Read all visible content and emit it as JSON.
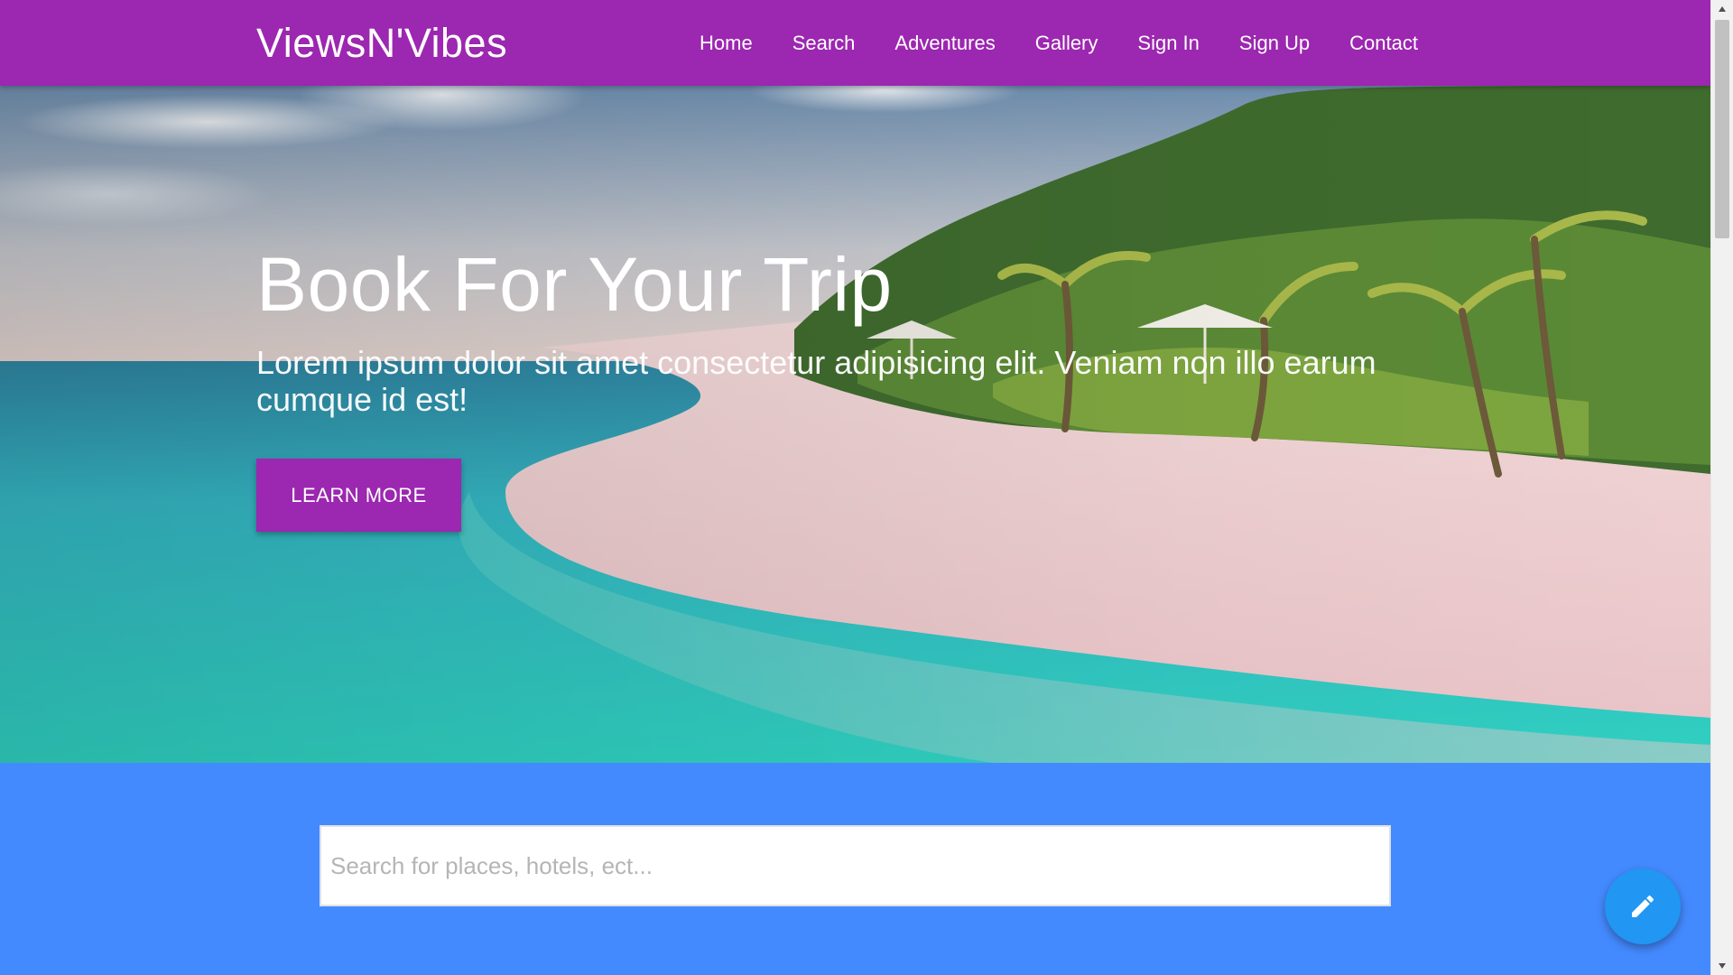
{
  "navbar": {
    "brand": "ViewsN'Vibes",
    "links": [
      {
        "label": "Home"
      },
      {
        "label": "Search"
      },
      {
        "label": "Adventures"
      },
      {
        "label": "Gallery"
      },
      {
        "label": "Sign In"
      },
      {
        "label": "Sign Up"
      },
      {
        "label": "Contact"
      }
    ]
  },
  "hero": {
    "title": "Book For Your Trip",
    "subtitle": "Lorem ipsum dolor sit amet consectetur adipisicing elit. Veniam non illo earum cumque id est!",
    "button_label": "LEARN MORE",
    "background_image": "tropical-beach-photo"
  },
  "search": {
    "placeholder": "Search for places, hotels, ect..."
  },
  "fab": {
    "icon": "pencil-icon"
  },
  "colors": {
    "primary": "#9c27b0",
    "search_section": "#448aff",
    "fab": "#2196f3"
  }
}
